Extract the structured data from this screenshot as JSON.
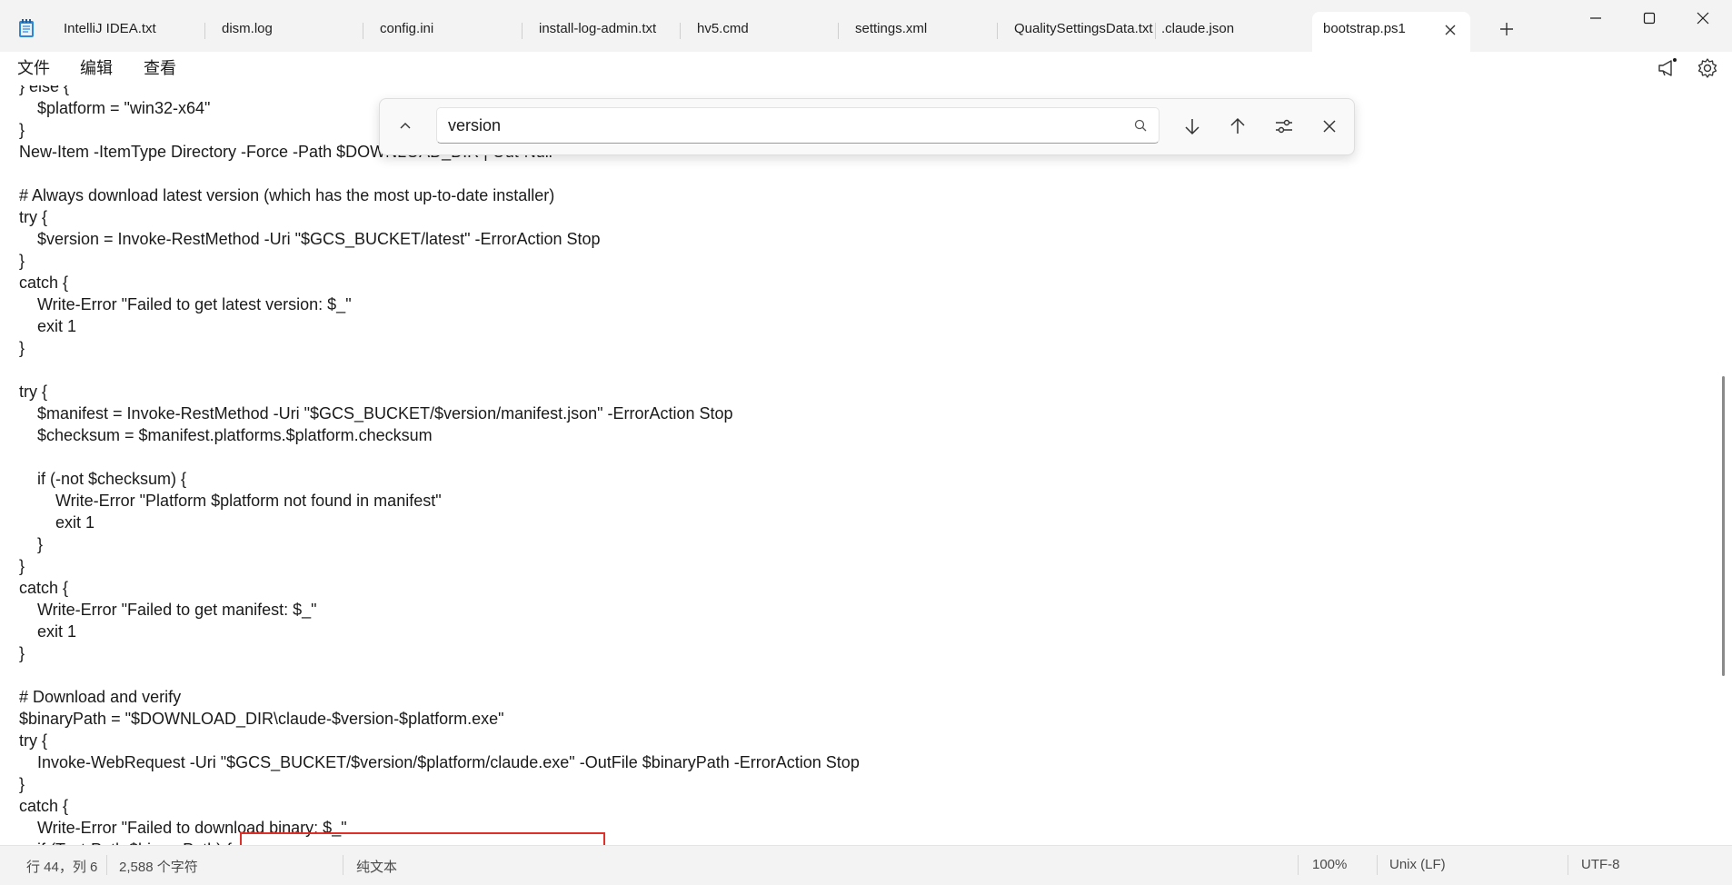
{
  "window": {
    "minimize_icon": "minimize-icon",
    "maximize_icon": "maximize-icon",
    "close_icon": "close-icon"
  },
  "tabs": [
    {
      "label": "IntelliJ IDEA.txt"
    },
    {
      "label": "dism.log"
    },
    {
      "label": "config.ini"
    },
    {
      "label": "install-log-admin.txt"
    },
    {
      "label": "hv5.cmd"
    },
    {
      "label": "settings.xml"
    },
    {
      "label": "QualitySettingsData.txt"
    },
    {
      "label": ".claude.json"
    },
    {
      "label": "bootstrap.ps1",
      "active": true
    }
  ],
  "menu": {
    "file": "文件",
    "edit": "编辑",
    "view": "查看"
  },
  "find": {
    "query": "version"
  },
  "code_lines": [
    "} else {",
    "    $platform = \"win32-x64\"",
    "}",
    "New-Item -ItemType Directory -Force -Path $DOWNLOAD_DIR | Out-Null",
    "",
    "# Always download latest version (which has the most up-to-date installer)",
    "try {",
    "    $version = Invoke-RestMethod -Uri \"$GCS_BUCKET/latest\" -ErrorAction Stop",
    "}",
    "catch {",
    "    Write-Error \"Failed to get latest version: $_\"",
    "    exit 1",
    "}",
    "",
    "try {",
    "    $manifest = Invoke-RestMethod -Uri \"$GCS_BUCKET/$version/manifest.json\" -ErrorAction Stop",
    "    $checksum = $manifest.platforms.$platform.checksum",
    "",
    "    if (-not $checksum) {",
    "        Write-Error \"Platform $platform not found in manifest\"",
    "        exit 1",
    "    }",
    "}",
    "catch {",
    "    Write-Error \"Failed to get manifest: $_\"",
    "    exit 1",
    "}",
    "",
    "# Download and verify",
    "$binaryPath = \"$DOWNLOAD_DIR\\claude-$version-$platform.exe\"",
    "try {",
    "    Invoke-WebRequest -Uri \"$GCS_BUCKET/$version/$platform/claude.exe\" -OutFile $binaryPath -ErrorAction Stop",
    "}",
    "catch {",
    "    Write-Error \"Failed to download binary: $_\"",
    "    if (Test-Path $binaryPath) {"
  ],
  "status": {
    "position": "行 44，列 6",
    "char_count": "2,588 个字符",
    "format": "纯文本",
    "zoom": "100%",
    "line_ending": "Unix (LF)",
    "encoding": "UTF-8"
  },
  "colors": {
    "highlight_border": "#e0302a",
    "tab_bar_bg": "#f3f3f3"
  }
}
